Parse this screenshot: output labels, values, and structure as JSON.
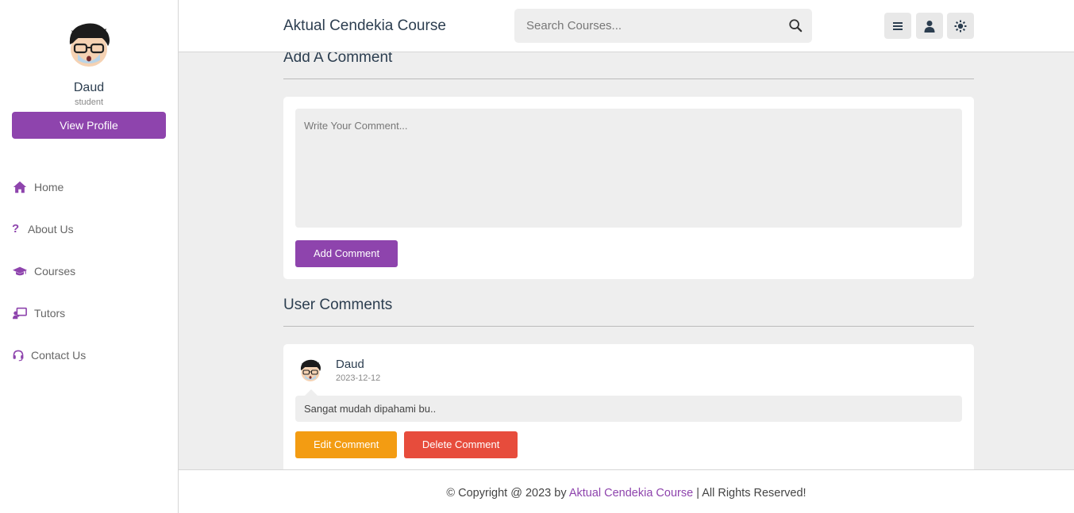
{
  "sidebar": {
    "user_name": "Daud",
    "user_role": "student",
    "view_profile_label": "View Profile",
    "nav": [
      {
        "label": "Home",
        "icon": "home-icon"
      },
      {
        "label": "About Us",
        "icon": "question-icon"
      },
      {
        "label": "Courses",
        "icon": "graduation-cap-icon"
      },
      {
        "label": "Tutors",
        "icon": "chalkboard-teacher-icon"
      },
      {
        "label": "Contact Us",
        "icon": "headset-icon"
      }
    ]
  },
  "header": {
    "brand": "Aktual Cendekia Course",
    "search_placeholder": "Search Courses..."
  },
  "add_comment": {
    "title": "Add A Comment",
    "placeholder": "Write Your Comment...",
    "button_label": "Add Comment"
  },
  "user_comments": {
    "title": "User Comments",
    "items": [
      {
        "name": "Daud",
        "date": "2023-12-12",
        "text": "Sangat mudah dipahami bu..",
        "edit_label": "Edit Comment",
        "delete_label": "Delete Comment"
      }
    ]
  },
  "footer": {
    "prefix": "© Copyright @ 2023 by",
    "brand": "Aktual Cendekia Course",
    "suffix": "| All Rights Reserved!"
  },
  "colors": {
    "accent": "#8e44ad",
    "edit": "#f39c12",
    "delete": "#e74c3c",
    "background": "#eeeeee"
  }
}
